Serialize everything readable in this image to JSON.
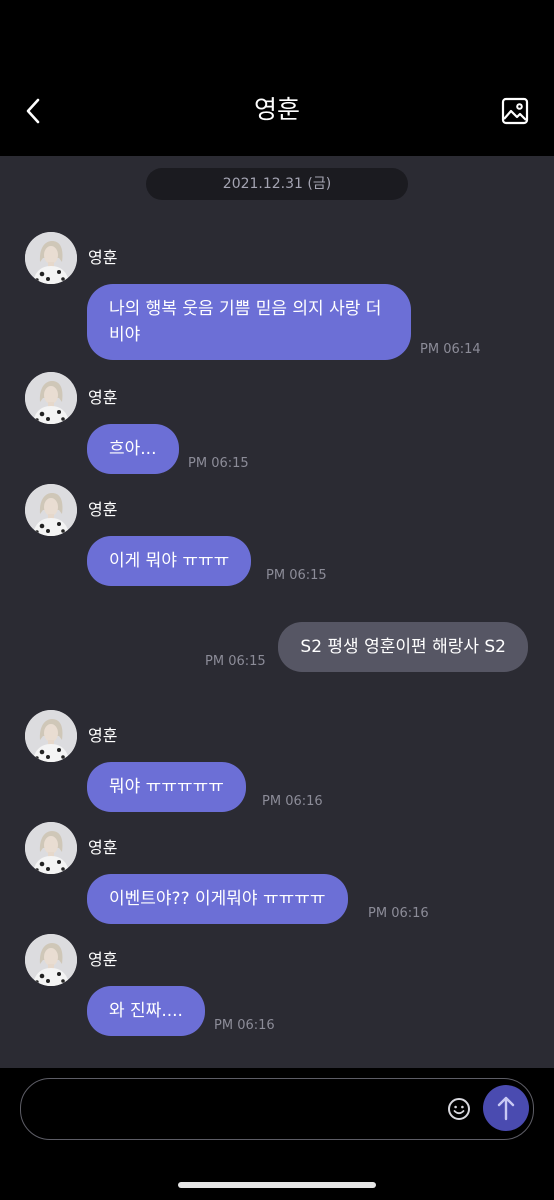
{
  "header": {
    "title": "영훈"
  },
  "chat": {
    "date": "2021.12.31 (금)",
    "messages": [
      {
        "sender": "영훈",
        "text": "나의 행복 웃음 기쁨 믿음 의지 사랑 더비야",
        "time": "PM 06:14"
      },
      {
        "sender": "영훈",
        "text": "흐아...",
        "time": "PM 06:15"
      },
      {
        "sender": "영훈",
        "text": "이게 뭐야 ㅠㅠㅠ",
        "time": "PM 06:15"
      },
      {
        "sender": "me",
        "text": "S2 평생 영훈이편 해랑사 S2",
        "time": "PM 06:15"
      },
      {
        "sender": "영훈",
        "text": "뭐야 ㅠㅠㅠㅠㅠ",
        "time": "PM 06:16"
      },
      {
        "sender": "영훈",
        "text": "이벤트야?? 이게뭐야 ㅠㅠㅠㅠ",
        "time": "PM 06:16"
      },
      {
        "sender": "영훈",
        "text": "와 진짜....",
        "time": "PM 06:16"
      }
    ]
  },
  "input": {
    "value": "",
    "placeholder": ""
  },
  "icons": {
    "back": "chevron-left-icon",
    "gallery": "image-icon",
    "emoji": "smiley-icon",
    "send": "arrow-up-icon"
  },
  "colors": {
    "background": "#2b2b33",
    "bar": "#000000",
    "bubble_received": "#6c6fd6",
    "bubble_sent": "#565664",
    "send_button": "#4a4bb0"
  }
}
